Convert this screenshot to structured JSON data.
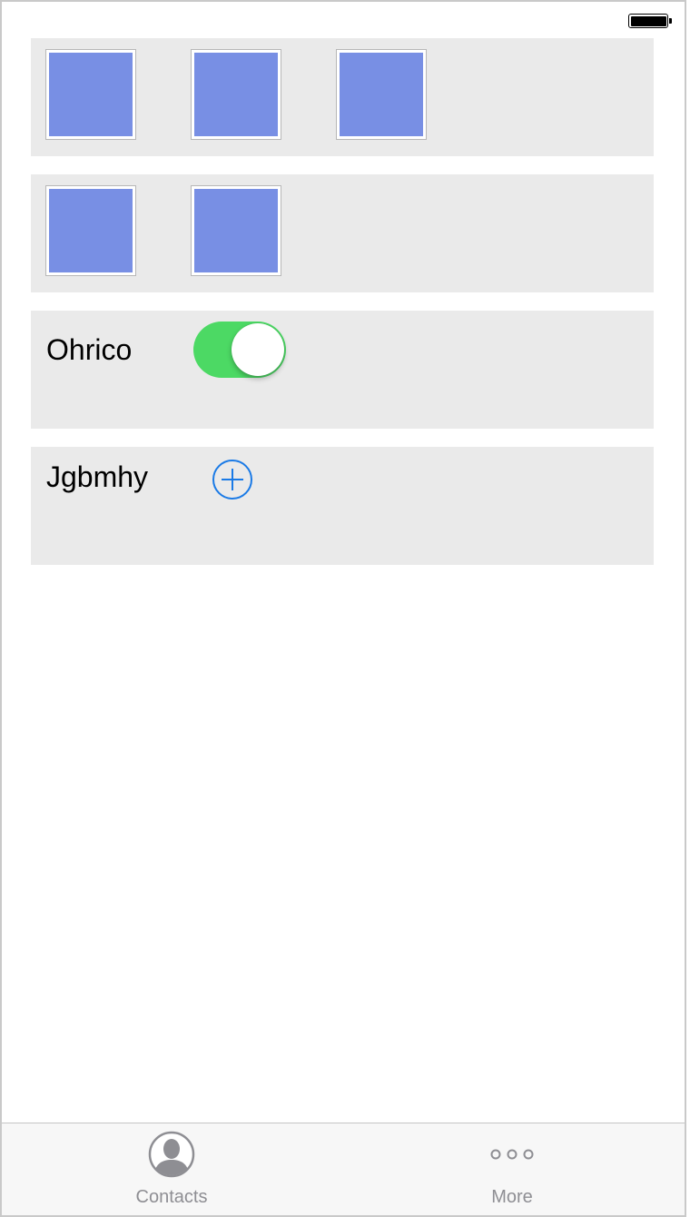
{
  "status_bar": {
    "battery_icon": "battery-full-icon"
  },
  "rows": [
    {
      "type": "image-row",
      "image_count": 3,
      "image_color": "#788fe4"
    },
    {
      "type": "image-row",
      "image_count": 2,
      "image_color": "#788fe4"
    },
    {
      "type": "toggle-row",
      "label": "Ohrico",
      "toggle_on": true,
      "toggle_color": "#4cd964"
    },
    {
      "type": "add-row",
      "label": "Jgbmhy",
      "icon": "add-circle-icon",
      "accent": "#1a7ae6"
    }
  ],
  "tab_bar": {
    "tabs": [
      {
        "label": "Contacts",
        "icon": "contacts-icon"
      },
      {
        "label": "More",
        "icon": "more-icon"
      }
    ]
  }
}
